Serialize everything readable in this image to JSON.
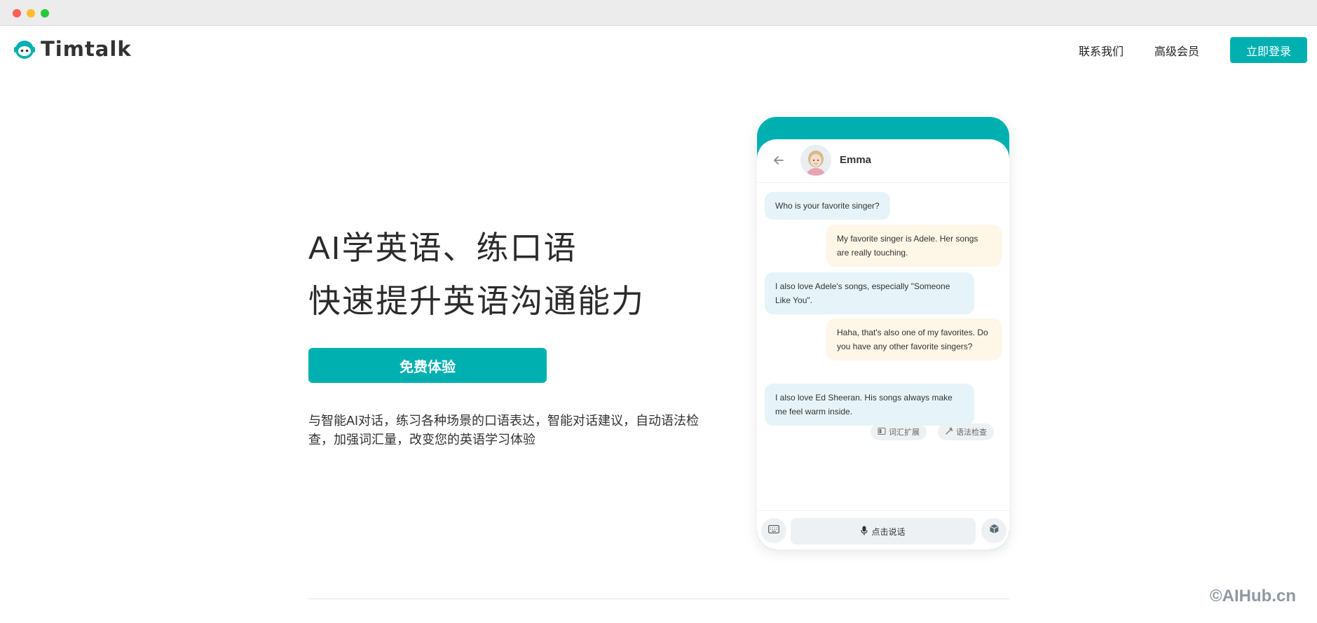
{
  "brand": {
    "name": "Timtalk",
    "color": "#00b0b0"
  },
  "nav": {
    "contact": "联系我们",
    "premium": "高级会员",
    "login": "立即登录"
  },
  "hero": {
    "title_line1": "AI学英语、练口语",
    "title_line2": "快速提升英语沟通能力",
    "cta": "免费体验",
    "description": "与智能AI对话，练习各种场景的口语表达，智能对话建议，自动语法检查，加强词汇量，改变您的英语学习体验"
  },
  "chat": {
    "contact_name": "Emma",
    "messages": [
      {
        "from": "ai",
        "text": "Who is your favorite singer?"
      },
      {
        "from": "me",
        "text": "My favorite singer is Adele. Her songs are really touching."
      },
      {
        "from": "ai",
        "text": "I also love Adele's songs, especially \"Someone Like You\"."
      },
      {
        "from": "me",
        "text": "Haha, that's also one of my favorites. Do you have any other favorite singers?"
      },
      {
        "from": "ai",
        "text": "I also love Ed Sheeran. His songs always make me feel warm inside."
      }
    ],
    "tools": {
      "vocab": "词汇扩展",
      "grammar": "语法检查"
    },
    "speak_label": "点击说话",
    "icons": [
      "back-arrow-icon",
      "keyboard-icon",
      "microphone-icon",
      "box-icon",
      "vocab-icon",
      "grammar-icon"
    ]
  },
  "watermark": "©AIHub.cn"
}
